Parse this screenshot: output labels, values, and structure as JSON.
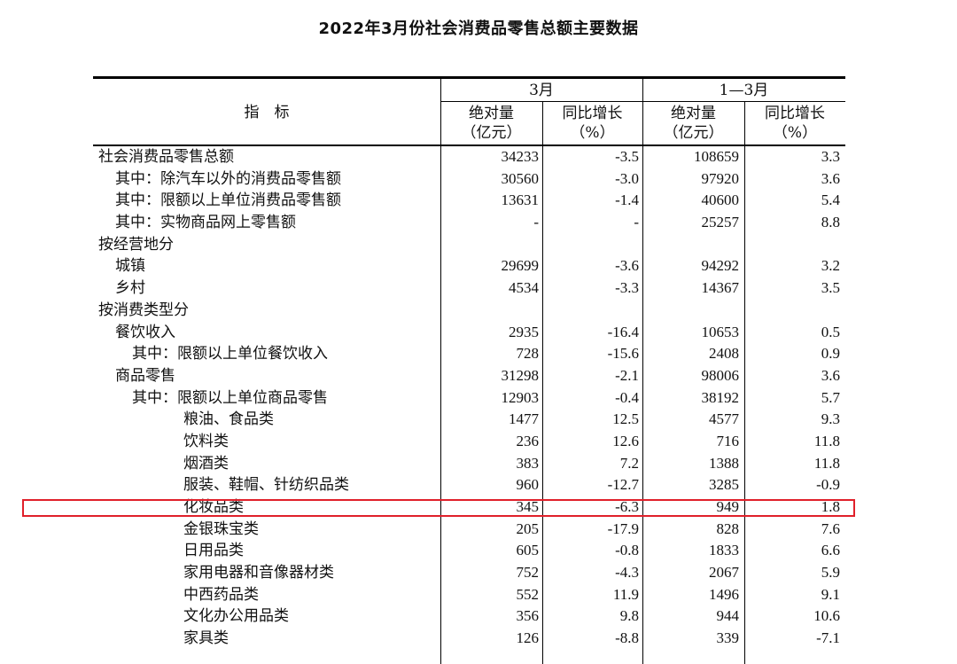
{
  "title": "2022年3月份社会消费品零售总额主要数据",
  "header": {
    "indicator": "指　标",
    "group_march": "3月",
    "group_q1": "1—3月",
    "abs_label_1": "绝对量",
    "abs_unit_1": "（亿元）",
    "yoy_label_1": "同比增长",
    "yoy_unit_1": "（%）",
    "abs_label_2": "绝对量",
    "abs_unit_2": "（亿元）",
    "yoy_label_2": "同比增长",
    "yoy_unit_2": "（%）"
  },
  "rows": [
    {
      "name": "社会消费品零售总额",
      "indent": 0,
      "m_abs": "34233",
      "m_yoy": "-3.5",
      "q_abs": "108659",
      "q_yoy": "3.3"
    },
    {
      "name": "其中：除汽车以外的消费品零售额",
      "indent": 1,
      "m_abs": "30560",
      "m_yoy": "-3.0",
      "q_abs": "97920",
      "q_yoy": "3.6"
    },
    {
      "name": "其中：限额以上单位消费品零售额",
      "indent": 1,
      "m_abs": "13631",
      "m_yoy": "-1.4",
      "q_abs": "40600",
      "q_yoy": "5.4"
    },
    {
      "name": "其中：实物商品网上零售额",
      "indent": 1,
      "m_abs": "-",
      "m_yoy": "-",
      "q_abs": "25257",
      "q_yoy": "8.8"
    },
    {
      "name": "按经营地分",
      "indent": 0,
      "m_abs": "",
      "m_yoy": "",
      "q_abs": "",
      "q_yoy": ""
    },
    {
      "name": "城镇",
      "indent": 1,
      "m_abs": "29699",
      "m_yoy": "-3.6",
      "q_abs": "94292",
      "q_yoy": "3.2"
    },
    {
      "name": "乡村",
      "indent": 1,
      "m_abs": "4534",
      "m_yoy": "-3.3",
      "q_abs": "14367",
      "q_yoy": "3.5"
    },
    {
      "name": "按消费类型分",
      "indent": 0,
      "m_abs": "",
      "m_yoy": "",
      "q_abs": "",
      "q_yoy": ""
    },
    {
      "name": "餐饮收入",
      "indent": 1,
      "m_abs": "2935",
      "m_yoy": "-16.4",
      "q_abs": "10653",
      "q_yoy": "0.5"
    },
    {
      "name": "其中：限额以上单位餐饮收入",
      "indent": 2,
      "m_abs": "728",
      "m_yoy": "-15.6",
      "q_abs": "2408",
      "q_yoy": "0.9"
    },
    {
      "name": "商品零售",
      "indent": 1,
      "m_abs": "31298",
      "m_yoy": "-2.1",
      "q_abs": "98006",
      "q_yoy": "3.6"
    },
    {
      "name": "其中：限额以上单位商品零售",
      "indent": 2,
      "m_abs": "12903",
      "m_yoy": "-0.4",
      "q_abs": "38192",
      "q_yoy": "5.7"
    },
    {
      "name": "粮油、食品类",
      "indent": 3,
      "m_abs": "1477",
      "m_yoy": "12.5",
      "q_abs": "4577",
      "q_yoy": "9.3"
    },
    {
      "name": "饮料类",
      "indent": 3,
      "m_abs": "236",
      "m_yoy": "12.6",
      "q_abs": "716",
      "q_yoy": "11.8"
    },
    {
      "name": "烟酒类",
      "indent": 3,
      "m_abs": "383",
      "m_yoy": "7.2",
      "q_abs": "1388",
      "q_yoy": "11.8"
    },
    {
      "name": "服装、鞋帽、针纺织品类",
      "indent": 3,
      "m_abs": "960",
      "m_yoy": "-12.7",
      "q_abs": "3285",
      "q_yoy": "-0.9"
    },
    {
      "name": "化妆品类",
      "indent": 3,
      "m_abs": "345",
      "m_yoy": "-6.3",
      "q_abs": "949",
      "q_yoy": "1.8"
    },
    {
      "name": "金银珠宝类",
      "indent": 3,
      "m_abs": "205",
      "m_yoy": "-17.9",
      "q_abs": "828",
      "q_yoy": "7.6"
    },
    {
      "name": "日用品类",
      "indent": 3,
      "m_abs": "605",
      "m_yoy": "-0.8",
      "q_abs": "1833",
      "q_yoy": "6.6"
    },
    {
      "name": "家用电器和音像器材类",
      "indent": 3,
      "m_abs": "752",
      "m_yoy": "-4.3",
      "q_abs": "2067",
      "q_yoy": "5.9"
    },
    {
      "name": "中西药品类",
      "indent": 3,
      "m_abs": "552",
      "m_yoy": "11.9",
      "q_abs": "1496",
      "q_yoy": "9.1"
    },
    {
      "name": "文化办公用品类",
      "indent": 3,
      "m_abs": "356",
      "m_yoy": "9.8",
      "q_abs": "944",
      "q_yoy": "10.6"
    },
    {
      "name": "家具类",
      "indent": 3,
      "m_abs": "126",
      "m_yoy": "-8.8",
      "q_abs": "339",
      "q_yoy": "-7.1"
    }
  ],
  "highlight_color": "#e0202a"
}
